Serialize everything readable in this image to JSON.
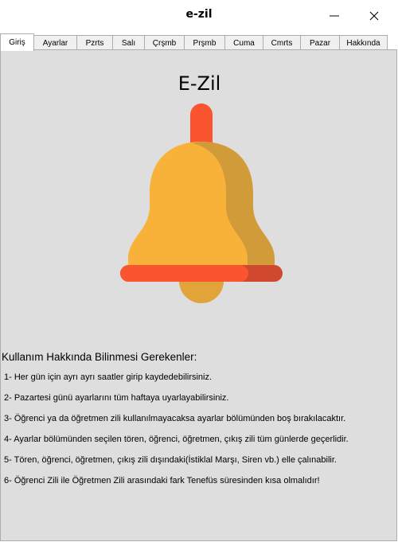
{
  "window": {
    "title": "e-zil",
    "minimize_glyph": "—",
    "close_glyph": "✕"
  },
  "tabs": [
    {
      "label": "Giriş",
      "active": true
    },
    {
      "label": "Ayarlar"
    },
    {
      "label": "Pzrts"
    },
    {
      "label": "Salı"
    },
    {
      "label": "Çrşmb"
    },
    {
      "label": "Prşmb"
    },
    {
      "label": "Cuma"
    },
    {
      "label": "Cmrts"
    },
    {
      "label": "Pazar"
    },
    {
      "label": "Hakkında"
    }
  ],
  "main": {
    "app_title": "E-Zil",
    "bell_icon": "bell-icon",
    "heading": "Kullanım Hakkında Bilinmesi Gerekenler:",
    "items": [
      "1- Her gün için ayrı ayrı saatler girip kaydedebilirsiniz.",
      "2- Pazartesi günü ayarlarını tüm haftaya uyarlayabilirsiniz.",
      "3- Öğrenci ya da öğretmen zili kullanılmayacaksa ayarlar bölümünden boş bırakılacaktır.",
      "4- Ayarlar bölümünden seçilen tören, öğrenci, öğretmen, çıkış zili tüm günlerde geçerlidir.",
      "5- Tören, öğrenci, öğretmen, çıkış zili dışındaki(İstiklal Marşı, Siren vb.) elle çalınabilir.",
      "6- Öğrenci Zili ile Öğretmen Zili arasındaki fark Tenefüs süresinden kısa olmalıdır!"
    ]
  },
  "colors": {
    "bell_body": "#f8b23a",
    "bell_shade": "#d19b3a",
    "bell_red": "#fb5530",
    "bell_red_shade": "#d0492e",
    "clapper": "#e2a33a",
    "panel_bg": "#dedede"
  }
}
